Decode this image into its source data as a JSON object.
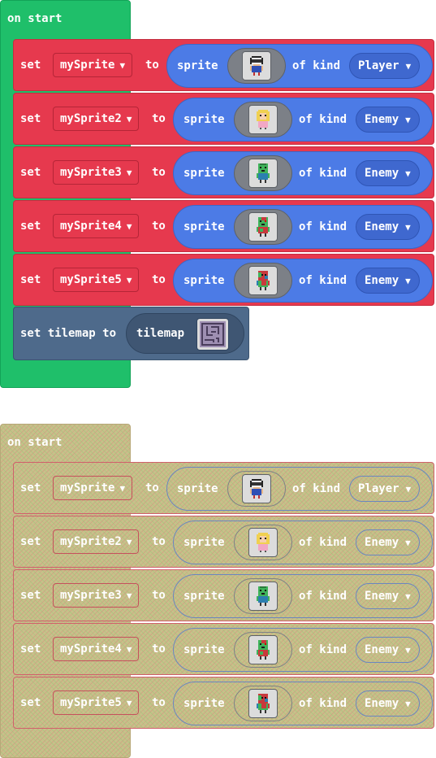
{
  "blocks": [
    {
      "hat_label": "on start",
      "rows": [
        {
          "set": "set",
          "var": "mySprite",
          "to": "to",
          "sprite": "sprite",
          "image": "player-sprite-image",
          "ofkind": "of kind",
          "kind": "Player"
        },
        {
          "set": "set",
          "var": "mySprite2",
          "to": "to",
          "sprite": "sprite",
          "image": "blonde-girl-sprite-image",
          "ofkind": "of kind",
          "kind": "Enemy"
        },
        {
          "set": "set",
          "var": "mySprite3",
          "to": "to",
          "sprite": "sprite",
          "image": "green-zombie-sprite-image",
          "ofkind": "of kind",
          "kind": "Enemy"
        },
        {
          "set": "set",
          "var": "mySprite4",
          "to": "to",
          "sprite": "sprite",
          "image": "zombie-red-sprite-image",
          "ofkind": "of kind",
          "kind": "Enemy"
        },
        {
          "set": "set",
          "var": "mySprite5",
          "to": "to",
          "sprite": "sprite",
          "image": "zombie-colorful-sprite-image",
          "ofkind": "of kind",
          "kind": "Enemy"
        }
      ],
      "tilemap": {
        "label": "set tilemap to",
        "value_label": "tilemap",
        "image": "tilemap-maze-image"
      }
    },
    {
      "hat_label": "on start",
      "rows": [
        {
          "set": "set",
          "var": "mySprite",
          "to": "to",
          "sprite": "sprite",
          "image": "player-sprite-image",
          "ofkind": "of kind",
          "kind": "Player"
        },
        {
          "set": "set",
          "var": "mySprite2",
          "to": "to",
          "sprite": "sprite",
          "image": "blonde-girl-sprite-image",
          "ofkind": "of kind",
          "kind": "Enemy"
        },
        {
          "set": "set",
          "var": "mySprite3",
          "to": "to",
          "sprite": "sprite",
          "image": "green-zombie-sprite-image",
          "ofkind": "of kind",
          "kind": "Enemy"
        },
        {
          "set": "set",
          "var": "mySprite4",
          "to": "to",
          "sprite": "sprite",
          "image": "zombie-red-sprite-image",
          "ofkind": "of kind",
          "kind": "Enemy"
        },
        {
          "set": "set",
          "var": "mySprite5",
          "to": "to",
          "sprite": "sprite",
          "image": "zombie-colorful-sprite-image",
          "ofkind": "of kind",
          "kind": "Enemy"
        }
      ]
    }
  ],
  "colors": {
    "event_green": "#1fbf6a",
    "variables_red": "#e6394e",
    "sprites_blue": "#4c7be6",
    "scene_slate": "#4e6a8b",
    "ghost_khaki": "#c8c08a"
  }
}
